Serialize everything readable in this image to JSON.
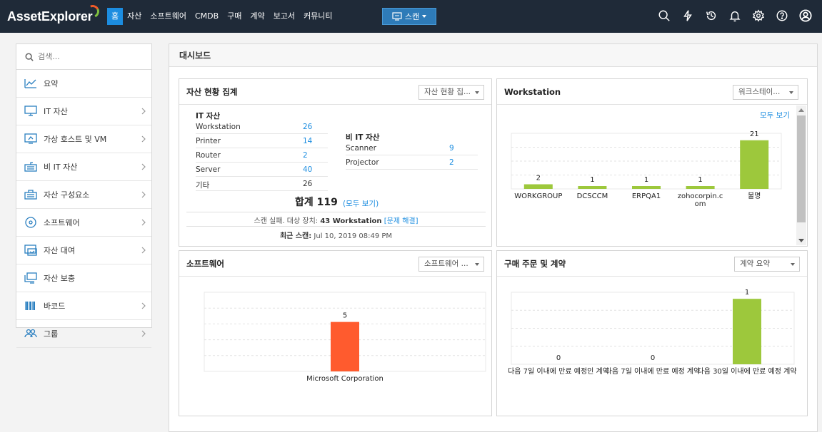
{
  "brand": {
    "logo_text": "AssetExplorer"
  },
  "nav": [
    {
      "label": "홈",
      "active": true
    },
    {
      "label": "자산",
      "active": false
    },
    {
      "label": "소프트웨어",
      "active": false
    },
    {
      "label": "CMDB",
      "active": false
    },
    {
      "label": "구매",
      "active": false
    },
    {
      "label": "계약",
      "active": false
    },
    {
      "label": "보고서",
      "active": false
    },
    {
      "label": "커뮤니티",
      "active": false
    }
  ],
  "scan_button": {
    "label": "스캔"
  },
  "top_icons": [
    "search-icon",
    "lightning-icon",
    "history-icon",
    "bell-icon",
    "gear-icon",
    "help-icon",
    "user-icon"
  ],
  "sidebar": {
    "search_placeholder": "검색...",
    "items": [
      {
        "label": "요약",
        "icon": "chart-line-icon",
        "has_children": false
      },
      {
        "label": "IT 자산",
        "icon": "monitor-icon",
        "has_children": true
      },
      {
        "label": "가상 호스트 및 VM",
        "icon": "virtual-host-icon",
        "has_children": true
      },
      {
        "label": "비 IT 자산",
        "icon": "keyboard-icon",
        "has_children": true
      },
      {
        "label": "자산 구성요소",
        "icon": "component-icon",
        "has_children": true
      },
      {
        "label": "소프트웨어",
        "icon": "disc-icon",
        "has_children": true
      },
      {
        "label": "자산 대여",
        "icon": "loan-icon",
        "has_children": true
      },
      {
        "label": "자산 보충",
        "icon": "replenish-icon",
        "has_children": false
      },
      {
        "label": "바코드",
        "icon": "barcode-icon",
        "has_children": true
      },
      {
        "label": "그룹",
        "icon": "group-icon",
        "has_children": true
      }
    ]
  },
  "main": {
    "title": "대시보드"
  },
  "widgets": {
    "asset_summary": {
      "title": "자산 현황 집계",
      "select": "자산 현황 집...",
      "it_title": "IT 자산",
      "it_rows": [
        {
          "name": "Workstation",
          "value": "26",
          "link": true
        },
        {
          "name": "Printer",
          "value": "14",
          "link": true
        },
        {
          "name": "Router",
          "value": "2",
          "link": true
        },
        {
          "name": "Server",
          "value": "40",
          "link": true
        },
        {
          "name": "기타",
          "value": "26",
          "link": false
        }
      ],
      "nonit_title": "비 IT 자산",
      "nonit_rows": [
        {
          "name": "Scanner",
          "value": "9",
          "link": true
        },
        {
          "name": "Projector",
          "value": "2",
          "link": true
        }
      ],
      "total_label": "합계 119",
      "total_link": "(모두 보기)",
      "scan_fail_prefix": "스캔 실패. 대상 장치:",
      "scan_fail_count": "43 Workstation",
      "scan_fail_link": "[문제 해결]",
      "last_scan_label": "최근 스캔:",
      "last_scan_value": "Jul 10, 2019 08:49 PM"
    },
    "workstation": {
      "title": "Workstation",
      "select": "워크스테이...",
      "view_all": "모두 보기",
      "chart_data": {
        "type": "bar",
        "categories": [
          "WORKGROUP",
          "DCSCCM",
          "ERPQA1",
          "zohocorpin.com",
          "불명"
        ],
        "values": [
          2,
          1,
          1,
          1,
          21
        ],
        "color": "#9dc83c"
      }
    },
    "software": {
      "title": "소프트웨어",
      "select": "소프트웨어 ...",
      "chart_data": {
        "type": "bar",
        "categories": [
          "Microsoft Corporation"
        ],
        "values": [
          5
        ],
        "color": "#ff5b2e"
      }
    },
    "purchase": {
      "title": "구매 주문 및 계약",
      "select": "계약 요약",
      "chart_data": {
        "type": "bar",
        "categories": [
          "다음 7일 이내에 만료 예정인 계약",
          "다음 7일 이내에 만료 예정 계약",
          "다음 30일 이내에 만료 예정 계약"
        ],
        "values": [
          0,
          0,
          1
        ],
        "color": "#9dc83c"
      }
    }
  }
}
